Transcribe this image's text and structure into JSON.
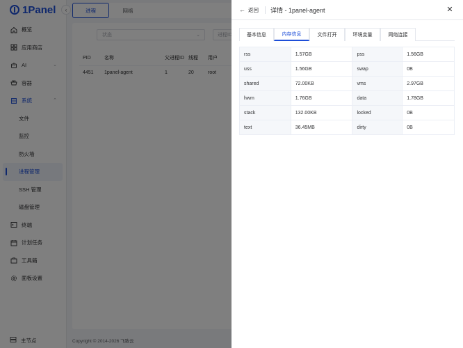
{
  "app": {
    "logo_text": "1Panel",
    "copyright": "Copyright © 2014-2026 飞致云"
  },
  "sidebar": {
    "items": [
      {
        "label": "概览",
        "icon": "home-icon"
      },
      {
        "label": "应用商店",
        "icon": "grid-icon"
      },
      {
        "label": "AI",
        "icon": "robot-icon"
      },
      {
        "label": "容器",
        "icon": "container-icon"
      },
      {
        "label": "系统",
        "icon": "system-icon"
      },
      {
        "label": "文件"
      },
      {
        "label": "监控"
      },
      {
        "label": "防火墙"
      },
      {
        "label": "进程管理"
      },
      {
        "label": "SSH 管理"
      },
      {
        "label": "磁盘管理"
      },
      {
        "label": "终端",
        "icon": "terminal-icon"
      },
      {
        "label": "计划任务",
        "icon": "calendar-icon"
      },
      {
        "label": "工具箱",
        "icon": "toolbox-icon"
      },
      {
        "label": "面板设置",
        "icon": "gear-icon"
      }
    ],
    "node_label": "主节点"
  },
  "main": {
    "tabs": [
      {
        "label": "进程"
      },
      {
        "label": "网络"
      }
    ],
    "filters": {
      "status_placeholder": "状态",
      "second_placeholder": "进程ID"
    },
    "table": {
      "headers": {
        "pid": "PID",
        "name": "名称",
        "ppid": "父进程ID",
        "threads": "线程",
        "user": "用户"
      },
      "row": {
        "pid": "4451",
        "name": "1panel-agent",
        "ppid": "1",
        "threads": "20",
        "user": "root"
      }
    }
  },
  "drawer": {
    "back_label": "返回",
    "title": "详情 - 1panel-agent",
    "tabs": [
      {
        "label": "基本信息"
      },
      {
        "label": "内存信息"
      },
      {
        "label": "文件打开"
      },
      {
        "label": "环境变量"
      },
      {
        "label": "网络连接"
      }
    ],
    "memory": [
      {
        "k1": "rss",
        "v1": "1.57GB",
        "k2": "pss",
        "v2": "1.56GB"
      },
      {
        "k1": "uss",
        "v1": "1.56GB",
        "k2": "swap",
        "v2": "0B"
      },
      {
        "k1": "shared",
        "v1": "72.00KB",
        "k2": "vms",
        "v2": "2.97GB"
      },
      {
        "k1": "hwm",
        "v1": "1.76GB",
        "k2": "data",
        "v2": "1.78GB"
      },
      {
        "k1": "stack",
        "v1": "132.00KB",
        "k2": "locked",
        "v2": "0B"
      },
      {
        "k1": "text",
        "v1": "36.45MB",
        "k2": "dirty",
        "v2": "0B"
      }
    ]
  },
  "colors": {
    "accent": "#1d4ed8",
    "overlay": "rgba(0,0,0,0.5)"
  }
}
